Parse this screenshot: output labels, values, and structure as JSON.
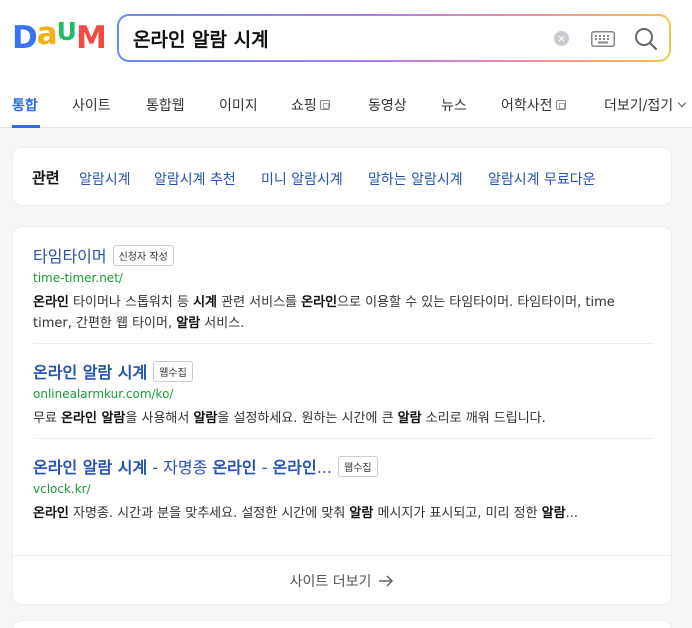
{
  "logo": {
    "letters": [
      "D",
      "a",
      "U",
      "M"
    ],
    "text": "Daum"
  },
  "search": {
    "query": "온라인 알람 시계",
    "clear_icon": "×"
  },
  "tabs": [
    {
      "label": "통합"
    },
    {
      "label": "사이트"
    },
    {
      "label": "통합웹"
    },
    {
      "label": "이미지"
    },
    {
      "label": "쇼핑"
    },
    {
      "label": "동영상"
    },
    {
      "label": "뉴스"
    },
    {
      "label": "어학사전"
    },
    {
      "label": "더보기/접기"
    }
  ],
  "related": {
    "title": "관련",
    "links": [
      "알람시계",
      "알람시계 추천",
      "미니 알람시계",
      "말하는 알람시계",
      "알람시계 무료다운"
    ]
  },
  "results": [
    {
      "title": "타임타이머",
      "badge": "신청자 작성",
      "url": "time-timer.net/",
      "desc": [
        [
          "b",
          "온라인"
        ],
        [
          "t",
          " 타이머나 스톱워치 등 "
        ],
        [
          "b",
          "시계"
        ],
        [
          "t",
          " 관련 서비스를 "
        ],
        [
          "b",
          "온라인"
        ],
        [
          "t",
          "으로 이용할 수 있는 타임타이머. 타임타이머, time timer, 간편한 웹 타이머, "
        ],
        [
          "b",
          "알람"
        ],
        [
          "t",
          " 서비스."
        ]
      ]
    },
    {
      "title": "온라인 알람 시계",
      "badge": "웹수집",
      "url": "onlinealarmkur.com/ko/",
      "desc": [
        [
          "t",
          "무료 "
        ],
        [
          "b",
          "온라인 알람"
        ],
        [
          "t",
          "을 사용해서 "
        ],
        [
          "b",
          "알람"
        ],
        [
          "t",
          "을 설정하세요. 원하는 시간에 큰 "
        ],
        [
          "b",
          "알람"
        ],
        [
          "t",
          " 소리로 깨워 드립니다."
        ]
      ]
    },
    {
      "title_parts": [
        [
          "b",
          "온라인 알람 시계"
        ],
        [
          "t",
          " - 자명종 "
        ],
        [
          "b",
          "온라인"
        ],
        [
          "t",
          " - "
        ],
        [
          "b",
          "온라인"
        ],
        [
          "t",
          "..."
        ]
      ],
      "badge": "웹수집",
      "url": "vclock.kr/",
      "desc": [
        [
          "b",
          "온라인"
        ],
        [
          "t",
          " 자명종. 시간과 분을 맞추세요. 설정한 시간에 맞춰 "
        ],
        [
          "b",
          "알람"
        ],
        [
          "t",
          " 메시지가 표시되고, 미리 정한 "
        ],
        [
          "b",
          "알람"
        ],
        [
          "t",
          "..."
        ]
      ]
    }
  ],
  "more": {
    "label": "사이트 더보기"
  },
  "colors": {
    "accent": "#2f6ce0",
    "link": "#2552b5",
    "url": "#1a9b3a"
  }
}
